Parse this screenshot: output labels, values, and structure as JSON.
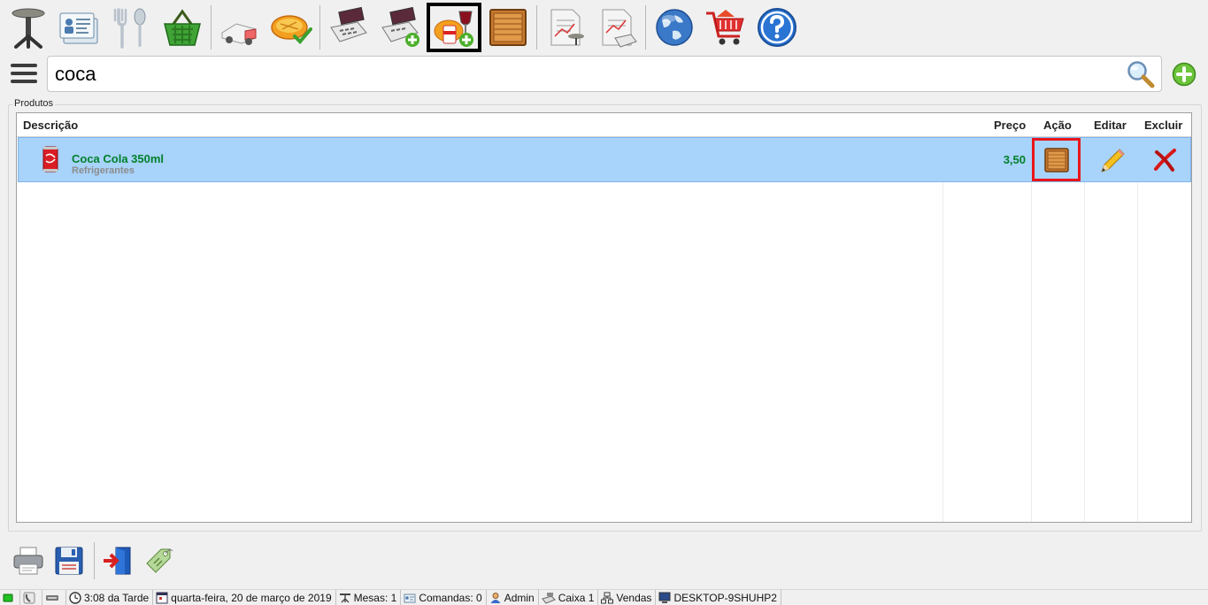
{
  "toolbar": {
    "buttons": [
      {
        "name": "table-stand-icon"
      },
      {
        "name": "customer-card-icon"
      },
      {
        "name": "cutlery-icon"
      },
      {
        "name": "green-basket-icon"
      },
      {
        "name": "delivery-truck-icon"
      },
      {
        "name": "pie-check-icon"
      },
      {
        "name": "cash-register-icon"
      },
      {
        "name": "cash-register-add-icon"
      },
      {
        "name": "add-product-icon",
        "selected": true
      },
      {
        "name": "wooden-crate-icon"
      },
      {
        "name": "report-table-icon"
      },
      {
        "name": "report-register-icon"
      },
      {
        "name": "globe-icon"
      },
      {
        "name": "shopping-cart-home-icon"
      },
      {
        "name": "help-icon"
      }
    ]
  },
  "search": {
    "value": "coca",
    "placeholder": ""
  },
  "products_group": {
    "label": "Produtos",
    "columns": {
      "description": "Descrição",
      "price": "Preço",
      "action": "Ação",
      "edit": "Editar",
      "delete": "Excluir"
    },
    "rows": [
      {
        "name": "Coca Cola 350ml",
        "category": "Refrigerantes",
        "price": "3,50"
      }
    ]
  },
  "statusbar": {
    "time": "3:08 da Tarde",
    "date": "quarta-feira, 20 de março de 2019",
    "tables": "Mesas: 1",
    "orders": "Comandas: 0",
    "user": "Admin",
    "cashier": "Caixa 1",
    "mode": "Vendas",
    "computer": "DESKTOP-9SHUHP2"
  },
  "colors": {
    "row_selected": "#a8d3fa",
    "product_text": "#00802b",
    "highlight": "#e8161b"
  }
}
